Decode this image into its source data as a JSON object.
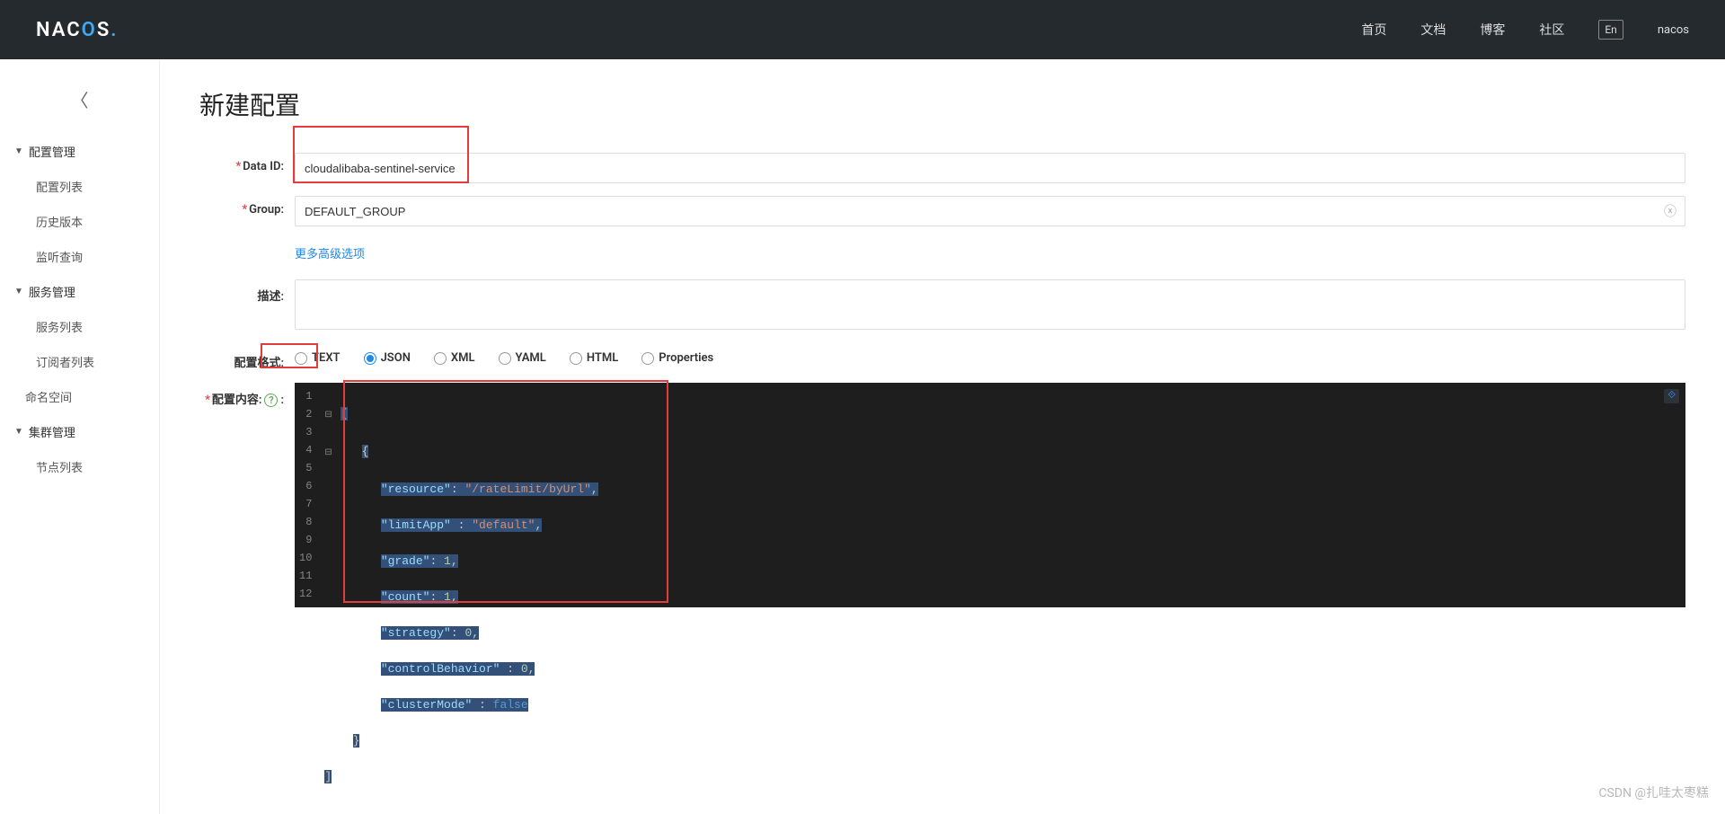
{
  "header": {
    "logo": "NACOS.",
    "nav": {
      "home": "首页",
      "docs": "文档",
      "blog": "博客",
      "community": "社区"
    },
    "lang": "En",
    "user": "nacos"
  },
  "sidebar": {
    "groups": {
      "config": "配置管理",
      "service": "服务管理",
      "cluster": "集群管理"
    },
    "items": {
      "configList": "配置列表",
      "history": "历史版本",
      "listen": "监听查询",
      "serviceList": "服务列表",
      "subscriber": "订阅者列表",
      "namespace": "命名空间",
      "nodeList": "节点列表"
    }
  },
  "page": {
    "title": "新建配置",
    "labels": {
      "dataId": "Data ID:",
      "group": "Group:",
      "more": "更多高级选项",
      "desc": "描述:",
      "format": "配置格式:",
      "content": "配置内容:"
    },
    "values": {
      "dataId": "cloudalibaba-sentinel-service",
      "group": "DEFAULT_GROUP",
      "desc": ""
    },
    "formats": [
      "TEXT",
      "JSON",
      "XML",
      "YAML",
      "HTML",
      "Properties"
    ],
    "selectedFormat": "JSON",
    "editorLines": [
      "1",
      "2",
      "3",
      "4",
      "5",
      "6",
      "7",
      "8",
      "9",
      "10",
      "11",
      "12"
    ],
    "code": {
      "l1": "[",
      "l2": "{",
      "k_resource": "\"resource\"",
      "v_resource": "\"/rateLimit/byUrl\"",
      "k_limitApp": "\"limitApp\"",
      "v_limitApp": "\"default\"",
      "k_grade": "\"grade\"",
      "v_grade": "1",
      "k_count": "\"count\"",
      "v_count": "1",
      "k_strategy": "\"strategy\"",
      "v_strategy": "0",
      "k_control": "\"controlBehavior\"",
      "v_control": "0",
      "k_cluster": "\"clusterMode\"",
      "v_cluster": "false",
      "l10": "}",
      "l11": "]"
    }
  },
  "watermark": "CSDN @扎哇太枣糕"
}
